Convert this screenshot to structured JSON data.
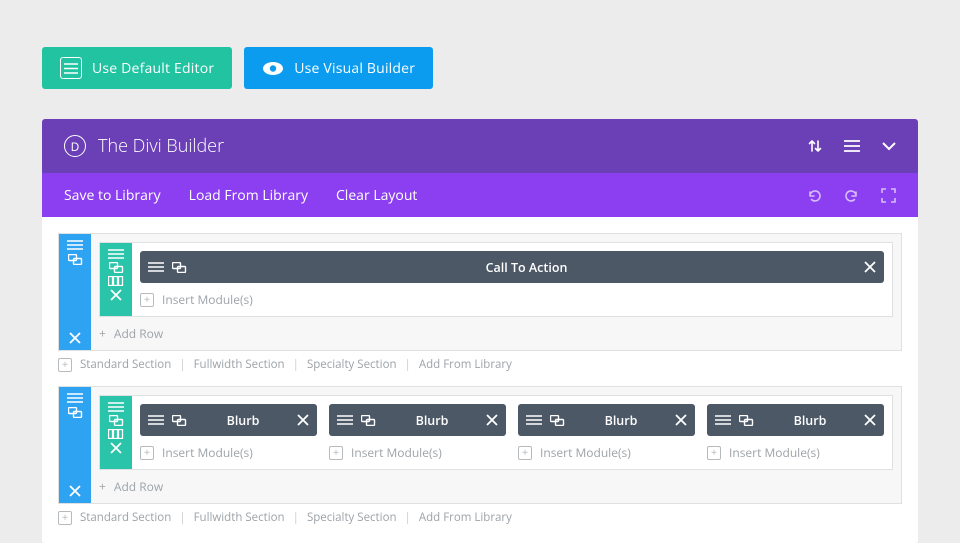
{
  "top_buttons": {
    "default_editor": "Use Default Editor",
    "visual_builder": "Use Visual Builder"
  },
  "header": {
    "title": "The Divi Builder",
    "logo_letter": "D"
  },
  "toolbar": {
    "save": "Save to Library",
    "load": "Load From Library",
    "clear": "Clear Layout"
  },
  "sections": [
    {
      "rows": [
        {
          "columns": [
            {
              "module": "Call To Action",
              "insert": "Insert Module(s)"
            }
          ]
        }
      ],
      "add_row": "Add Row",
      "links": [
        "Standard Section",
        "Fullwidth Section",
        "Specialty Section",
        "Add From Library"
      ]
    },
    {
      "rows": [
        {
          "columns": [
            {
              "module": "Blurb",
              "insert": "Insert Module(s)"
            },
            {
              "module": "Blurb",
              "insert": "Insert Module(s)"
            },
            {
              "module": "Blurb",
              "insert": "Insert Module(s)"
            },
            {
              "module": "Blurb",
              "insert": "Insert Module(s)"
            }
          ]
        }
      ],
      "add_row": "Add Row",
      "links": [
        "Standard Section",
        "Fullwidth Section",
        "Specialty Section",
        "Add From Library"
      ]
    }
  ]
}
